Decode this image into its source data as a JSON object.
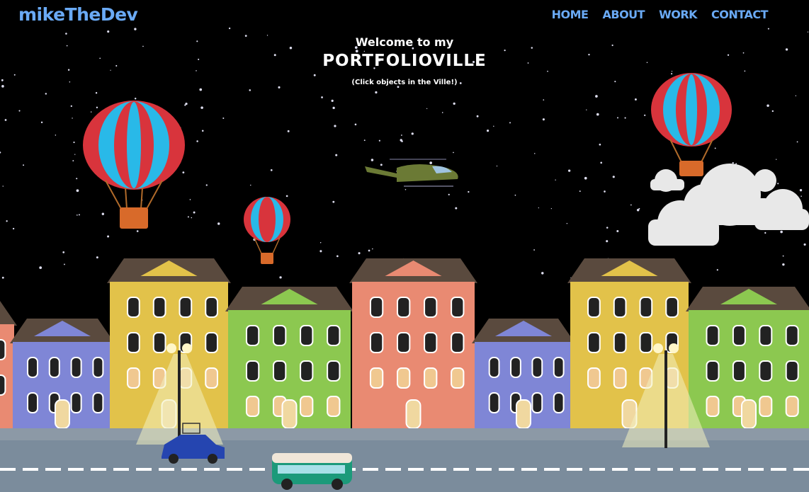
{
  "header": {
    "logo": "mikeTheDev",
    "nav": [
      {
        "label": "HOME"
      },
      {
        "label": "ABOUT"
      },
      {
        "label": "WORK"
      },
      {
        "label": "CONTACT"
      }
    ]
  },
  "hero": {
    "welcome": "Welcome to my",
    "title": "PORTFOLIOVILLE",
    "hint": "(Click objects in the Ville!)"
  },
  "colors": {
    "accent": "#6aaaf5",
    "sky": "#000000",
    "road": "#7b8c9c",
    "houses": [
      "#e98a72",
      "#7f86d6",
      "#e2c24a",
      "#8cc850",
      "#e98a72",
      "#7f86d6",
      "#e2c24a",
      "#8cc850"
    ]
  }
}
